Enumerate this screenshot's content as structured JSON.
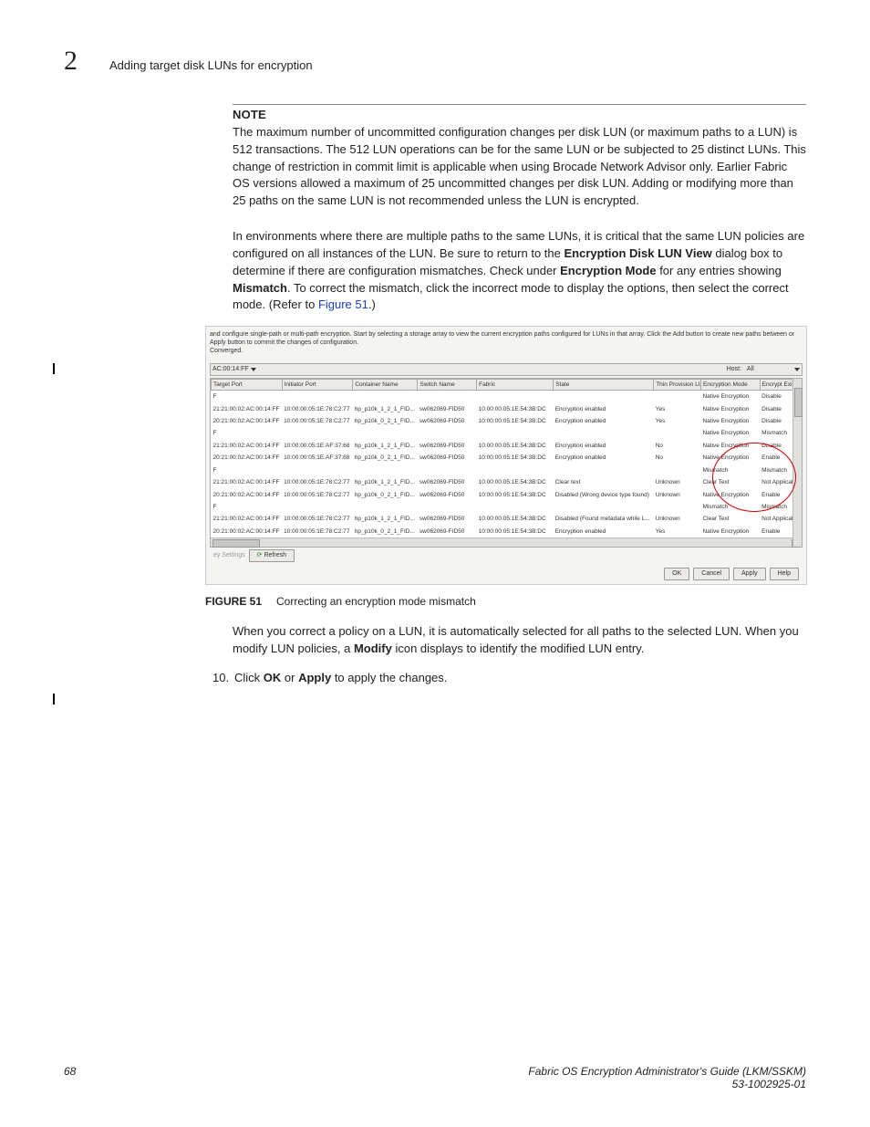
{
  "header": {
    "chapter_num": "2",
    "title": "Adding target disk LUNs for encryption"
  },
  "note_label": "NOTE",
  "note_body": "The maximum number of uncommitted configuration changes per disk LUN (or maximum paths to a LUN) is 512 transactions. The 512 LUN operations can be for the same LUN or be subjected to 25 distinct LUNs. This change of restriction in commit limit is applicable when using Brocade Network Advisor only. Earlier Fabric OS versions allowed a maximum of 25 uncommitted changes per disk LUN. Adding or modifying more than 25 paths on the same LUN is not recommended unless the LUN is encrypted.",
  "para1_a": "In environments where there are multiple paths to the same LUNs, it is critical that the same LUN policies are configured on all instances of the LUN. Be sure to return to the ",
  "para1_b": "Encryption Disk LUN View",
  "para1_c": " dialog box to determine if there are configuration mismatches. Check under ",
  "para1_d": "Encryption Mode",
  "para1_e": " for any entries showing ",
  "para1_f": "Mismatch",
  "para1_g": ". To correct the mismatch, click the incorrect mode to display the options, then select the correct mode. (Refer to ",
  "para1_link": "Figure 51",
  "para1_h": ".)",
  "figure": {
    "intro": "and configure single-path or multi-path encryption. Start by selecting a storage array to view the current encryption paths configured for LUNs in that array. Click the Add button to create new paths between or Apply button to commit the changes of configuration.",
    "converged": "Converged.",
    "dropdown": "AC:00:14:FF",
    "host_label": "Host:",
    "host_value": "All",
    "columns": [
      "Target Port",
      "Initiator Port",
      "Container Name",
      "Switch Name",
      "Fabric",
      "State",
      "Thin Provision LUN",
      "Encryption Mode",
      "Encrypt Exis"
    ],
    "rows": [
      {
        "tp": "F",
        "ip": "",
        "cn": "",
        "sn": "",
        "fb": "",
        "st": "",
        "tpl": "",
        "em": "Native Encryption",
        "ee": "Disable"
      },
      {
        "tp": "21:21:00:02:AC:00:14:FF",
        "ip": "10:00:00:05:1E:78:C2:77",
        "cn": "hp_p10k_1_2_1_FID...",
        "sn": "sw062069-FID50",
        "fb": "10:00:00:05:1E:54:3B:DC",
        "st": "Encryption enabled",
        "tpl": "Yes",
        "em": "Native Encryption",
        "ee": "Disable"
      },
      {
        "tp": "20:21:00:02:AC:00:14:FF",
        "ip": "10:00:00:05:1E:78:C2:77",
        "cn": "hp_p10k_0_2_1_FID...",
        "sn": "sw062069-FID50",
        "fb": "10:00:00:05:1E:54:3B:DC",
        "st": "Encryption enabled",
        "tpl": "Yes",
        "em": "Native Encryption",
        "ee": "Disable"
      },
      {
        "tp": "F",
        "ip": "",
        "cn": "",
        "sn": "",
        "fb": "",
        "st": "",
        "tpl": "",
        "em": "Native Encryption",
        "ee": "Mismatch"
      },
      {
        "tp": "21:21:00:02:AC:00:14:FF",
        "ip": "10:00:00:05:1E:AF:37:68",
        "cn": "hp_p10k_1_2_1_FID...",
        "sn": "sw062069-FID50",
        "fb": "10:00:00:05:1E:54:3B:DC",
        "st": "Encryption enabled",
        "tpl": "No",
        "em": "Native Encryption",
        "ee": "Disable"
      },
      {
        "tp": "20:21:00:02:AC:00:14:FF",
        "ip": "10:00:00:05:1E:AF:37:68",
        "cn": "hp_p10k_0_2_1_FID...",
        "sn": "sw062069-FID50",
        "fb": "10:00:00:05:1E:54:3B:DC",
        "st": "Encryption enabled",
        "tpl": "No",
        "em": "Native Encryption",
        "ee": "Enable"
      },
      {
        "tp": "F",
        "ip": "",
        "cn": "",
        "sn": "",
        "fb": "",
        "st": "",
        "tpl": "",
        "em": "Mismatch",
        "ee": "Mismatch"
      },
      {
        "tp": "21:21:00:02:AC:00:14:FF",
        "ip": "10:00:00:05:1E:78:C2:77",
        "cn": "hp_p10k_1_2_1_FID...",
        "sn": "sw062069-FID50",
        "fb": "10:00:00:05:1E:54:3B:DC",
        "st": "Clear text",
        "tpl": "Unknown",
        "em": "Clear Text",
        "ee": "Not Applicab"
      },
      {
        "tp": "20:21:00:02:AC:00:14:FF",
        "ip": "10:00:00:05:1E:78:C2:77",
        "cn": "hp_p10k_0_2_1_FID...",
        "sn": "sw062069-FID50",
        "fb": "10:00:00:05:1E:54:3B:DC",
        "st": "Disabled (Wrong device type found)",
        "tpl": "Unknown",
        "em": "Native Encryption",
        "ee": "Enable"
      },
      {
        "tp": "F",
        "ip": "",
        "cn": "",
        "sn": "",
        "fb": "",
        "st": "",
        "tpl": "",
        "em": "Mismatch",
        "ee": "Mismatch"
      },
      {
        "tp": "21:21:00:02:AC:00:14:FF",
        "ip": "10:00:00:05:1E:78:C2:77",
        "cn": "hp_p10k_1_2_1_FID...",
        "sn": "sw062069-FID50",
        "fb": "10:00:00:05:1E:54:3B:DC",
        "st": "Disabled (Found metadata while L...",
        "tpl": "Unknown",
        "em": "Clear Text",
        "ee": "Not Applicab..."
      },
      {
        "tp": "20:21:00:02:AC:00:14:FF",
        "ip": "10:00:00:05:1E:78:C2:77",
        "cn": "hp_p10k_0_2_1_FID...",
        "sn": "sw062069-FID50",
        "fb": "10:00:00:05:1E:54:3B:DC",
        "st": "Encryption enabled",
        "tpl": "Yes",
        "em": "Native Encryption",
        "ee": "Enable"
      }
    ],
    "settings": "ey Settings",
    "refresh": "Refresh",
    "ok": "OK",
    "cancel": "Cancel",
    "apply": "Apply",
    "help": "Help"
  },
  "figure_caption_num": "FIGURE 51",
  "figure_caption_text": "Correcting an encryption mode mismatch",
  "para2_a": "When you correct a policy on a LUN, it is automatically selected for all paths to the selected LUN. When you modify LUN policies, a ",
  "para2_b": "Modify",
  "para2_c": " icon displays to identify the modified LUN entry.",
  "step_num": "10.",
  "step_a": "Click ",
  "step_b": "OK",
  "step_c": " or ",
  "step_d": "Apply",
  "step_e": " to apply the changes.",
  "footer": {
    "page": "68",
    "title": "Fabric OS Encryption Administrator's Guide  (LKM/SSKM)",
    "docnum": "53-1002925-01"
  }
}
